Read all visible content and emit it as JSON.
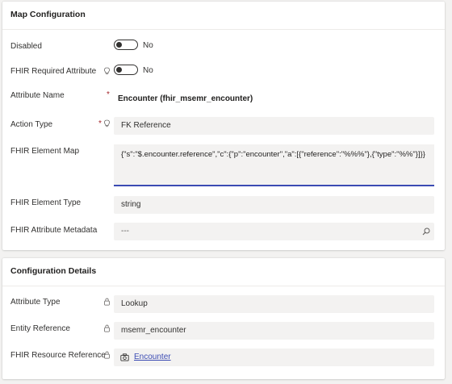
{
  "map_configuration": {
    "title": "Map Configuration",
    "disabled": {
      "label": "Disabled",
      "value": "No"
    },
    "fhir_required_attribute": {
      "label": "FHIR Required Attribute",
      "value": "No"
    },
    "attribute_name": {
      "label": "Attribute Name",
      "required_mark": "*",
      "value": "Encounter (fhir_msemr_encounter)"
    },
    "action_type": {
      "label": "Action Type",
      "required_mark": "*",
      "value": "FK Reference"
    },
    "fhir_element_map": {
      "label": "FHIR Element Map",
      "value": "{\"s\":\"$.encounter.reference\",\"c\":{\"p\":\"encounter\",\"a\":[{\"reference\":\"%%%\"},{\"type\":\"%%\"}]}}"
    },
    "fhir_element_type": {
      "label": "FHIR Element Type",
      "value": "string"
    },
    "fhir_attribute_metadata": {
      "label": "FHIR Attribute Metadata",
      "placeholder": "---"
    }
  },
  "configuration_details": {
    "title": "Configuration Details",
    "attribute_type": {
      "label": "Attribute Type",
      "value": "Lookup"
    },
    "entity_reference": {
      "label": "Entity Reference",
      "value": "msemr_encounter"
    },
    "fhir_resource_reference": {
      "label": "FHIR Resource Reference",
      "value": "Encounter"
    }
  },
  "colors": {
    "accent": "#3b4bb3",
    "required": "#a4262c",
    "field_bg": "#f3f2f1"
  },
  "icons": [
    "lightbulb-icon",
    "lock-icon",
    "search-icon",
    "entity-icon"
  ]
}
